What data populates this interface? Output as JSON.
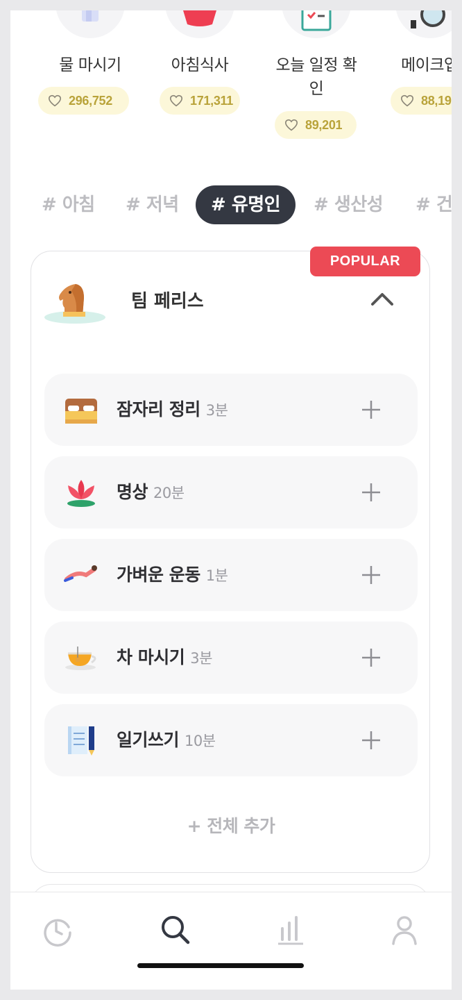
{
  "routines": [
    {
      "name": "물 마시기",
      "likes": "296,752",
      "icon": "water-glass-icon"
    },
    {
      "name": "아침식사",
      "likes": "171,311",
      "icon": "breakfast-bowl-icon"
    },
    {
      "name": "오늘 일정 확인",
      "name_line2": "인",
      "name_line1": "오늘 일정 확",
      "likes": "89,201",
      "icon": "calendar-check-icon"
    },
    {
      "name": "메이크업",
      "name_visible": "메이크업",
      "likes": "88,19",
      "icon": "mirror-icon"
    }
  ],
  "tags": [
    "# 아침",
    "# 저녁",
    "# 유명인",
    "# 생산성",
    "# 건"
  ],
  "active_tag": "# 유명인",
  "card": {
    "badge": "POPULAR",
    "title": "팀 페리스",
    "avatar_icon": "chess-knight-icon",
    "items": [
      {
        "title": "잠자리 정리",
        "duration": "3분",
        "icon": "bed-icon"
      },
      {
        "title": "명상",
        "duration": "20분",
        "icon": "lotus-icon"
      },
      {
        "title": "가벼운 운동",
        "duration": "1분",
        "icon": "stretching-icon"
      },
      {
        "title": "차 마시기",
        "duration": "3분",
        "icon": "tea-cup-icon"
      },
      {
        "title": "일기쓰기",
        "duration": "10분",
        "icon": "notebook-pencil-icon"
      }
    ],
    "add_all": "+ 전체 추가"
  },
  "tabs": [
    "history-clock-icon",
    "search-icon",
    "stats-bar-icon",
    "profile-icon"
  ],
  "colors": {
    "accent_dark": "#343842",
    "badge_red": "#ec4a55",
    "like_text": "#b9a33a",
    "like_bg": "#fcf7d9"
  }
}
